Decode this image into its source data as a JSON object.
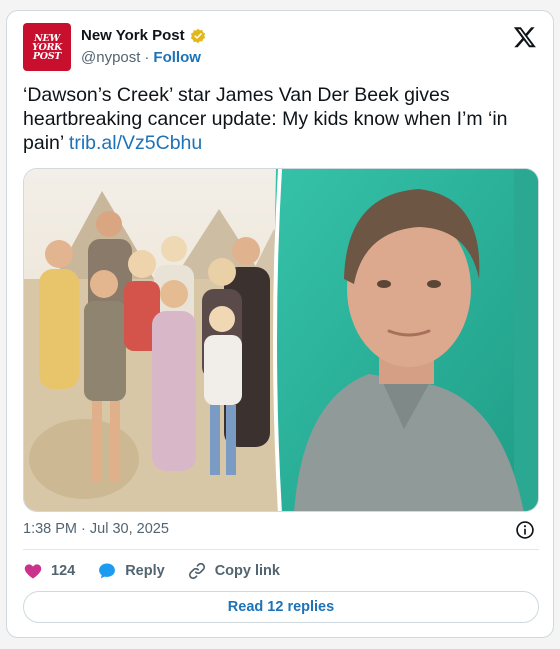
{
  "author": {
    "logo_lines": [
      "NEW",
      "YORK",
      "POST"
    ],
    "name": "New York Post",
    "handle": "@nypost",
    "separator": "·",
    "follow_label": "Follow",
    "verified_color": "#e2b719",
    "logo_color": "#c8102e"
  },
  "tweet": {
    "text": "‘Dawson’s Creek’ star James Van Der Beek gives heartbreaking cancer update: My kids know when I’m ‘in pain’ ",
    "link": "trib.al/Vz5Cbhu",
    "timestamp": "1:38 PM · Jul 30, 2025"
  },
  "media": {
    "left_image": "family-photo-pyramids",
    "right_image": "man-portrait-green-background"
  },
  "actions": {
    "like_count": "124",
    "reply_label": "Reply",
    "copy_label": "Copy link"
  },
  "replies_button": "Read 12 replies",
  "colors": {
    "link": "#1d72b8",
    "like": "#c9338c",
    "reply_bubble": "#1d9bf0",
    "muted": "#536471"
  }
}
